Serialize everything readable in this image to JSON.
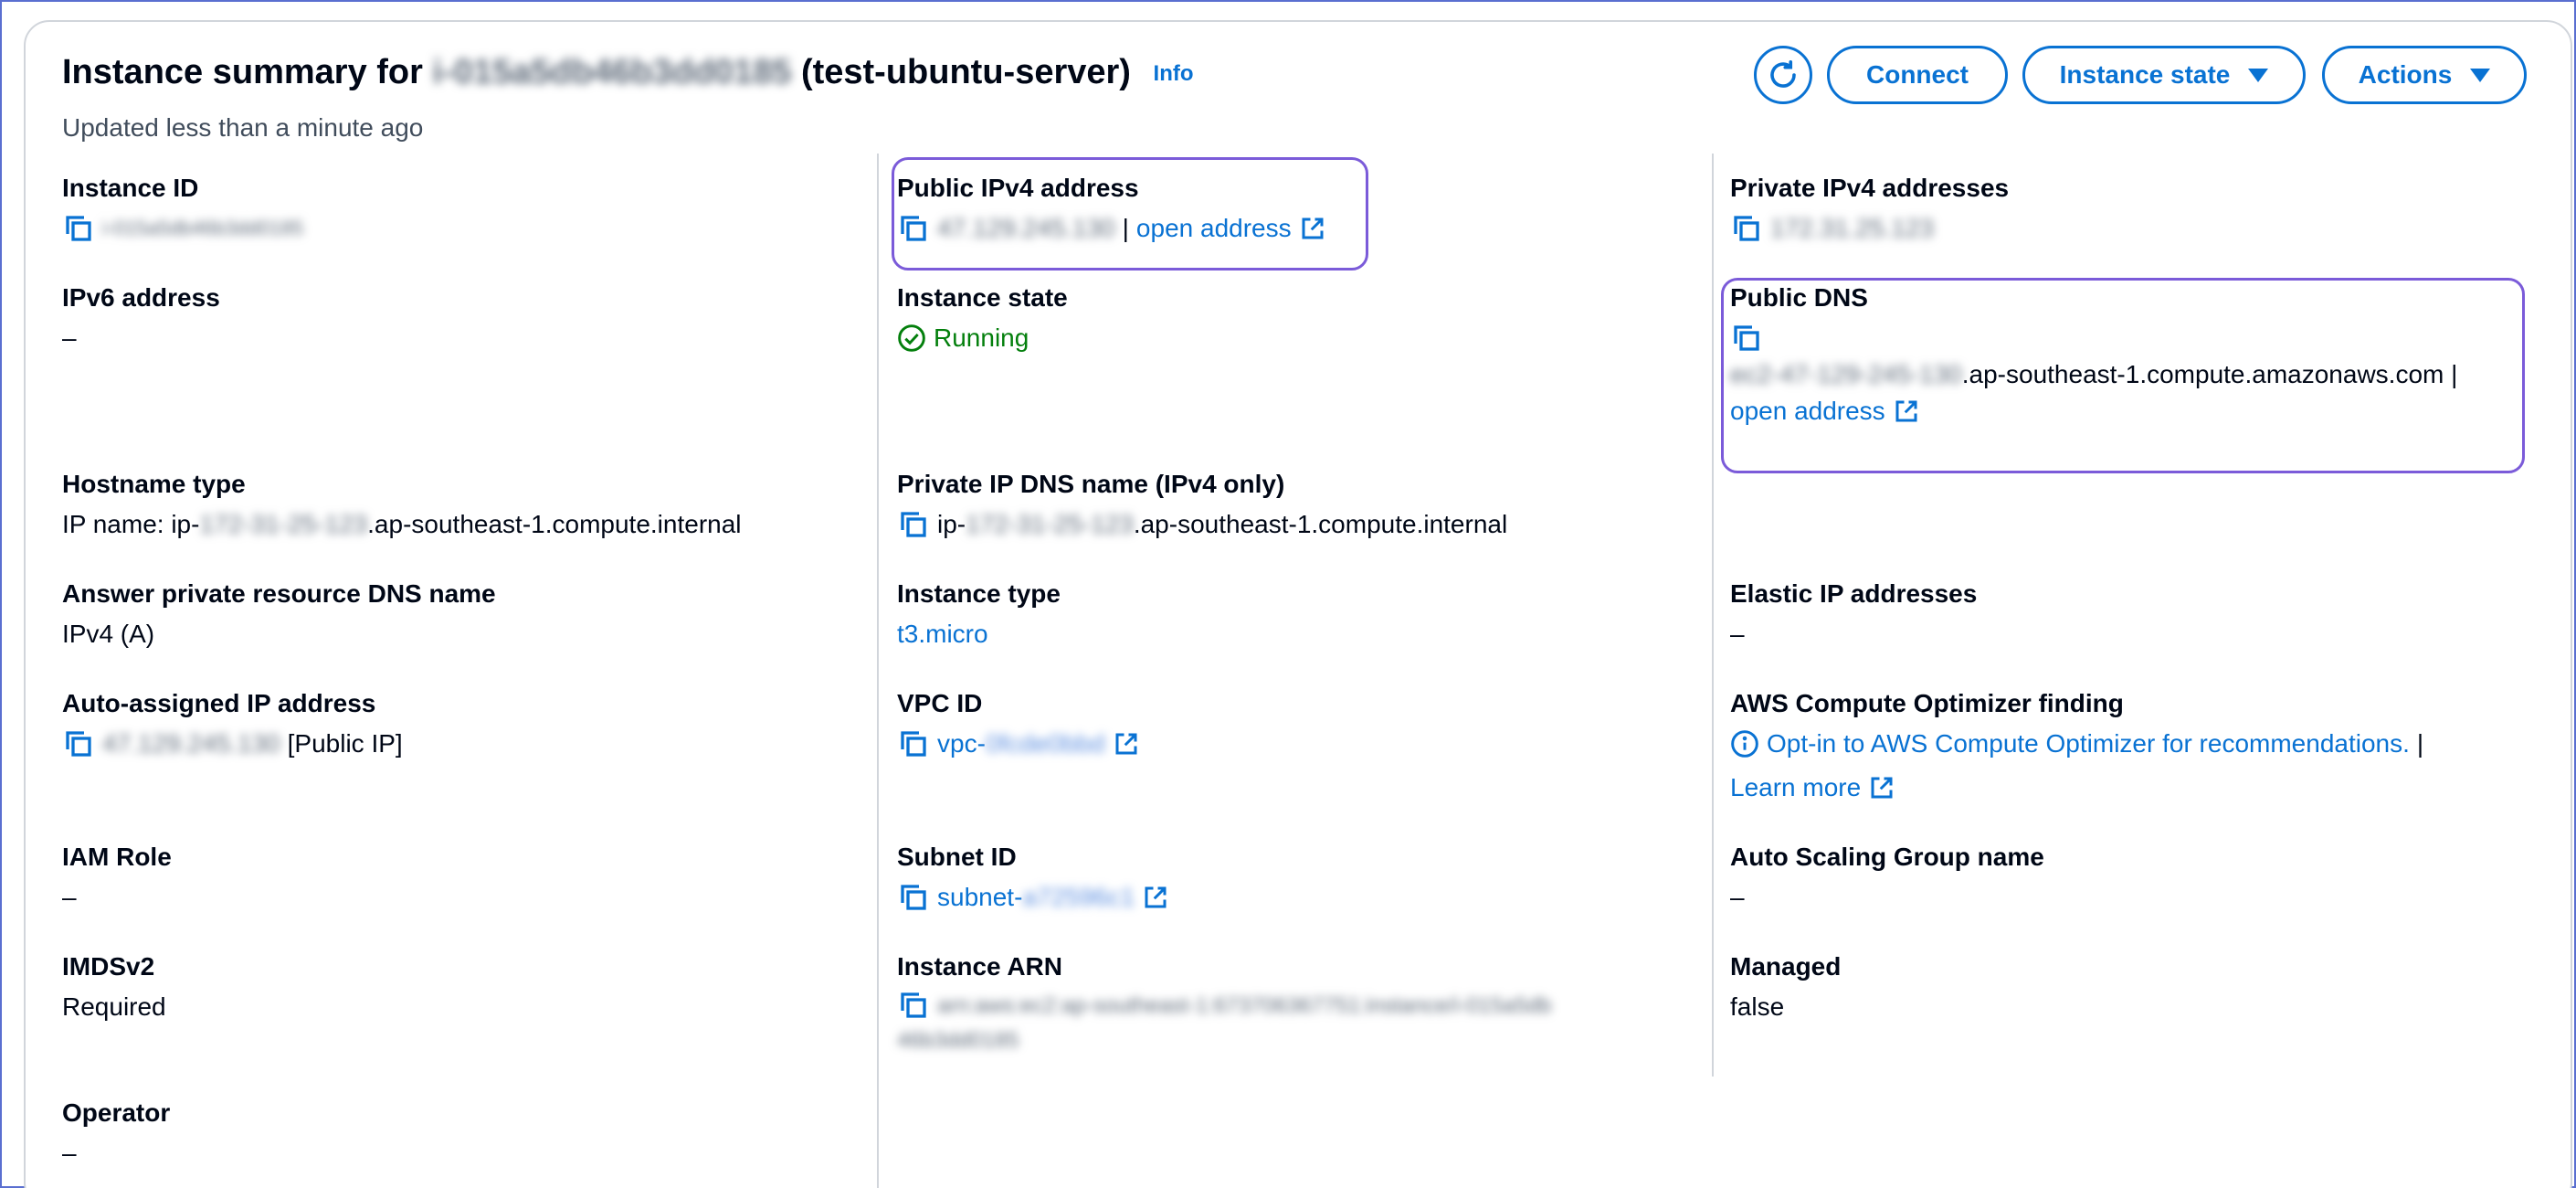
{
  "header": {
    "title_prefix": "Instance summary for",
    "instance_id_blurred": "i-015a5db46b3dd0185",
    "instance_name": "(test-ubuntu-server)",
    "info_label": "Info",
    "updated_text": "Updated less than a minute ago"
  },
  "toolbar": {
    "connect_label": "Connect",
    "instance_state_label": "Instance state",
    "actions_label": "Actions"
  },
  "fields": {
    "instance_id": {
      "label": "Instance ID",
      "value": "i-015a5db46b3dd0185"
    },
    "public_ipv4": {
      "label": "Public IPv4 address",
      "value": "47.129.245.130",
      "separator": "|",
      "link": "open address"
    },
    "private_ipv4": {
      "label": "Private IPv4 addresses",
      "value": "172.31.25.123"
    },
    "ipv6": {
      "label": "IPv6 address",
      "value": "–"
    },
    "instance_state": {
      "label": "Instance state",
      "value": "Running"
    },
    "public_dns": {
      "label": "Public DNS",
      "value_blurred": "ec2-47-129-245-130",
      "value_suffix": ".ap-southeast-1.compute.amazonaws.com |",
      "link": "open address"
    },
    "hostname_type": {
      "label": "Hostname type",
      "prefix": "IP name: ip-",
      "blurred": "172-31-25-123",
      "suffix": ".ap-southeast-1.compute.internal"
    },
    "private_ip_dns": {
      "label": "Private IP DNS name (IPv4 only)",
      "prefix": "ip-",
      "blurred": "172-31-25-123",
      "suffix": ".ap-southeast-1.compute.internal"
    },
    "answer_dns": {
      "label": "Answer private resource DNS name",
      "value": "IPv4 (A)"
    },
    "instance_type": {
      "label": "Instance type",
      "value": "t3.micro"
    },
    "elastic_ip": {
      "label": "Elastic IP addresses",
      "value": "–"
    },
    "auto_assigned_ip": {
      "label": "Auto-assigned IP address",
      "blurred": "47.129.245.130",
      "suffix": "[Public IP]"
    },
    "vpc_id": {
      "label": "VPC ID",
      "prefix": "vpc-",
      "blurred": "0fcde0bbd"
    },
    "compute_optimizer": {
      "label": "AWS Compute Optimizer finding",
      "link": "Opt-in to AWS Compute Optimizer for recommendations.",
      "separator": "|",
      "learn_more": "Learn more"
    },
    "iam_role": {
      "label": "IAM Role",
      "value": "–"
    },
    "subnet_id": {
      "label": "Subnet ID",
      "prefix": "subnet-",
      "blurred": "a72596c1"
    },
    "asg_name": {
      "label": "Auto Scaling Group name",
      "value": "–"
    },
    "imdsv2": {
      "label": "IMDSv2",
      "value": "Required"
    },
    "instance_arn": {
      "label": "Instance ARN",
      "line1": "arn:aws:ec2:ap-southeast-1:673706367751:instance/i-015a5db",
      "line2": "46b3dd0185"
    },
    "managed": {
      "label": "Managed",
      "value": "false"
    },
    "operator": {
      "label": "Operator",
      "value": "–"
    }
  },
  "colors": {
    "link": "#0972d3",
    "running": "#037f0c",
    "highlight": "#7b5bd9",
    "divider": "#d1d5db"
  }
}
